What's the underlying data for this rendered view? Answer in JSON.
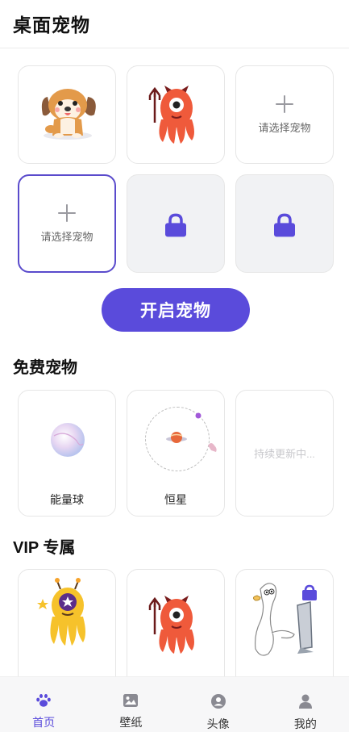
{
  "header": {
    "title": "桌面宠物"
  },
  "slots": {
    "add_label_1": "请选择宠物",
    "add_label_2": "请选择宠物"
  },
  "start_button": {
    "label": "开启宠物"
  },
  "free_section": {
    "title": "免费宠物",
    "items": [
      {
        "label": "能量球"
      },
      {
        "label": "恒星"
      },
      {
        "placeholder": "持续更新中..."
      }
    ]
  },
  "vip_section": {
    "title": "VIP 专属"
  },
  "tabbar": {
    "tabs": [
      {
        "label": "首页",
        "icon": "paw-icon",
        "active": true
      },
      {
        "label": "壁纸",
        "icon": "image-icon",
        "active": false
      },
      {
        "label": "头像",
        "icon": "avatar-face-icon",
        "active": false
      },
      {
        "label": "我的",
        "icon": "person-icon",
        "active": false
      }
    ]
  },
  "colors": {
    "accent": "#5a4bdb",
    "lock": "#5a4bdb",
    "star": "#f6c22b"
  }
}
